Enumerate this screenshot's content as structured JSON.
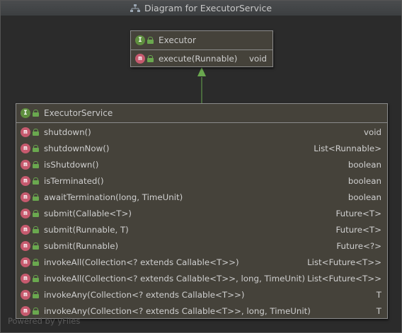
{
  "window": {
    "title": "Diagram for ExecutorService"
  },
  "executor": {
    "name": "Executor",
    "badge": "I",
    "methods": [
      {
        "badge": "m",
        "name": "execute(Runnable)",
        "returns": "void"
      }
    ]
  },
  "executor_service": {
    "name": "ExecutorService",
    "badge": "I",
    "methods": [
      {
        "badge": "m",
        "name": "shutdown()",
        "returns": "void"
      },
      {
        "badge": "m",
        "name": "shutdownNow()",
        "returns": "List<Runnable>"
      },
      {
        "badge": "m",
        "name": "isShutdown()",
        "returns": "boolean"
      },
      {
        "badge": "m",
        "name": "isTerminated()",
        "returns": "boolean"
      },
      {
        "badge": "m",
        "name": "awaitTermination(long, TimeUnit)",
        "returns": "boolean"
      },
      {
        "badge": "m",
        "name": "submit(Callable<T>)",
        "returns": "Future<T>"
      },
      {
        "badge": "m",
        "name": "submit(Runnable, T)",
        "returns": "Future<T>"
      },
      {
        "badge": "m",
        "name": "submit(Runnable)",
        "returns": "Future<?>"
      },
      {
        "badge": "m",
        "name": "invokeAll(Collection<? extends Callable<T>>)",
        "returns": "List<Future<T>>"
      },
      {
        "badge": "m",
        "name": "invokeAll(Collection<? extends Callable<T>>, long, TimeUnit)",
        "returns": "List<Future<T>>"
      },
      {
        "badge": "m",
        "name": "invokeAny(Collection<? extends Callable<T>>)",
        "returns": "T"
      },
      {
        "badge": "m",
        "name": "invokeAny(Collection<? extends Callable<T>>, long, TimeUnit)",
        "returns": "T"
      }
    ]
  },
  "footer": {
    "text": "Powered by yFiles"
  },
  "colors": {
    "background": "#2b2b2b",
    "node_fill": "#45423a",
    "node_border": "#8b8b8b",
    "interface_badge": "#5f8f3f",
    "method_badge": "#c65a6e",
    "visibility_lock": "#6aa84f",
    "inheritance_edge": "#6aa84f"
  },
  "icons": {
    "title": "hierarchy-icon",
    "interface": "interface-badge-icon",
    "method": "method-badge-icon",
    "visibility": "public-lock-icon"
  }
}
